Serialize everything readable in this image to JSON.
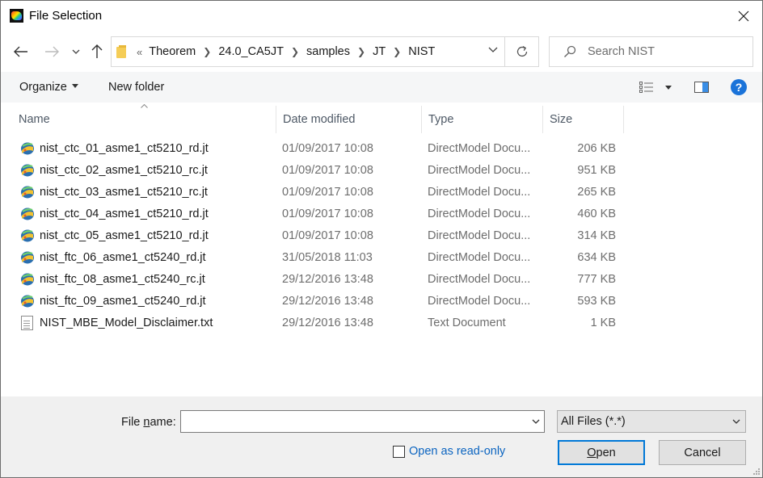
{
  "window": {
    "title": "File Selection"
  },
  "nav": {
    "breadcrumb_lead": "«",
    "breadcrumbs": [
      "Theorem",
      "24.0_CA5JT",
      "samples",
      "JT",
      "NIST"
    ],
    "search_placeholder": "Search NIST"
  },
  "toolbar": {
    "organize_label": "Organize",
    "new_folder_label": "New folder",
    "help_label": "?"
  },
  "columns": {
    "name": "Name",
    "date": "Date modified",
    "type": "Type",
    "size": "Size"
  },
  "files": [
    {
      "name": "nist_ctc_01_asme1_ct5210_rd.jt",
      "date": "01/09/2017 10:08",
      "type": "DirectModel Docu...",
      "size": "206 KB",
      "icon": "jt-file-icon"
    },
    {
      "name": "nist_ctc_02_asme1_ct5210_rc.jt",
      "date": "01/09/2017 10:08",
      "type": "DirectModel Docu...",
      "size": "951 KB",
      "icon": "jt-file-icon"
    },
    {
      "name": "nist_ctc_03_asme1_ct5210_rc.jt",
      "date": "01/09/2017 10:08",
      "type": "DirectModel Docu...",
      "size": "265 KB",
      "icon": "jt-file-icon"
    },
    {
      "name": "nist_ctc_04_asme1_ct5210_rd.jt",
      "date": "01/09/2017 10:08",
      "type": "DirectModel Docu...",
      "size": "460 KB",
      "icon": "jt-file-icon"
    },
    {
      "name": "nist_ctc_05_asme1_ct5210_rd.jt",
      "date": "01/09/2017 10:08",
      "type": "DirectModel Docu...",
      "size": "314 KB",
      "icon": "jt-file-icon"
    },
    {
      "name": "nist_ftc_06_asme1_ct5240_rd.jt",
      "date": "31/05/2018 11:03",
      "type": "DirectModel Docu...",
      "size": "634 KB",
      "icon": "jt-file-icon"
    },
    {
      "name": "nist_ftc_08_asme1_ct5240_rc.jt",
      "date": "29/12/2016 13:48",
      "type": "DirectModel Docu...",
      "size": "777 KB",
      "icon": "jt-file-icon"
    },
    {
      "name": "nist_ftc_09_asme1_ct5240_rd.jt",
      "date": "29/12/2016 13:48",
      "type": "DirectModel Docu...",
      "size": "593 KB",
      "icon": "jt-file-icon"
    },
    {
      "name": "NIST_MBE_Model_Disclaimer.txt",
      "date": "29/12/2016 13:48",
      "type": "Text Document",
      "size": "1 KB",
      "icon": "text-file-icon"
    }
  ],
  "bottom": {
    "file_name_label_pre": "File ",
    "file_name_label_u": "n",
    "file_name_label_post": "ame:",
    "file_name_value": "",
    "filter_value": "All Files (*.*)",
    "readonly_label": "Open as read-only",
    "readonly_checked": false,
    "open_label_u": "O",
    "open_label_rest": "pen",
    "cancel_label": "Cancel"
  },
  "colors": {
    "accent": "#0078d7",
    "link": "#0b64c0",
    "help": "#1a73d9"
  }
}
